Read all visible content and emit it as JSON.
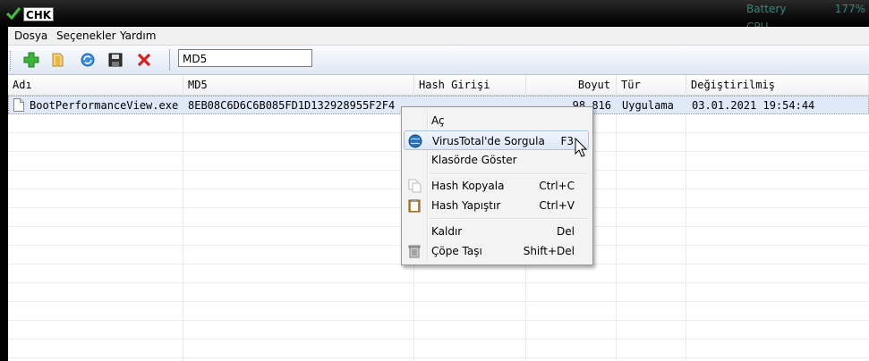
{
  "titlebar": {
    "app_title": "CHK"
  },
  "gadget": {
    "battery_label": "Battery",
    "battery_value": "177%",
    "cpu_label": "CPU"
  },
  "menu": {
    "file": "Dosya",
    "options": "Seçenekler",
    "help": "Yardım"
  },
  "toolbar": {
    "hash_type": "MD5",
    "icons": [
      "add-icon",
      "open-folder-icon",
      "refresh-icon",
      "save-icon",
      "remove-icon"
    ]
  },
  "columns": [
    "Adı",
    "MD5",
    "Hash Girişi",
    "Boyut",
    "Tür",
    "Değiştirilmiş"
  ],
  "rows": [
    {
      "name": "BootPerformanceView.exe",
      "md5": "8EB08C6D6C6B085FD1D132928955F2F4",
      "hash_input": "",
      "size": "98.816",
      "type": "Uygulama",
      "modified": "03.01.2021 19:54:44"
    }
  ],
  "context_menu": {
    "open": "Aç",
    "virustotal": "VirusTotal'de Sorgula",
    "virustotal_key": "F3",
    "show_in_folder": "Klasörde Göster",
    "copy_hash": "Hash Kopyala",
    "copy_hash_key": "Ctrl+C",
    "paste_hash": "Hash Yapıştır",
    "paste_hash_key": "Ctrl+V",
    "remove": "Kaldır",
    "remove_key": "Del",
    "trash": "Çöpe Taşı",
    "trash_key": "Shift+Del"
  },
  "colors": {
    "selection": "#dfe9f8",
    "gadget_text": "#2d8a80"
  }
}
